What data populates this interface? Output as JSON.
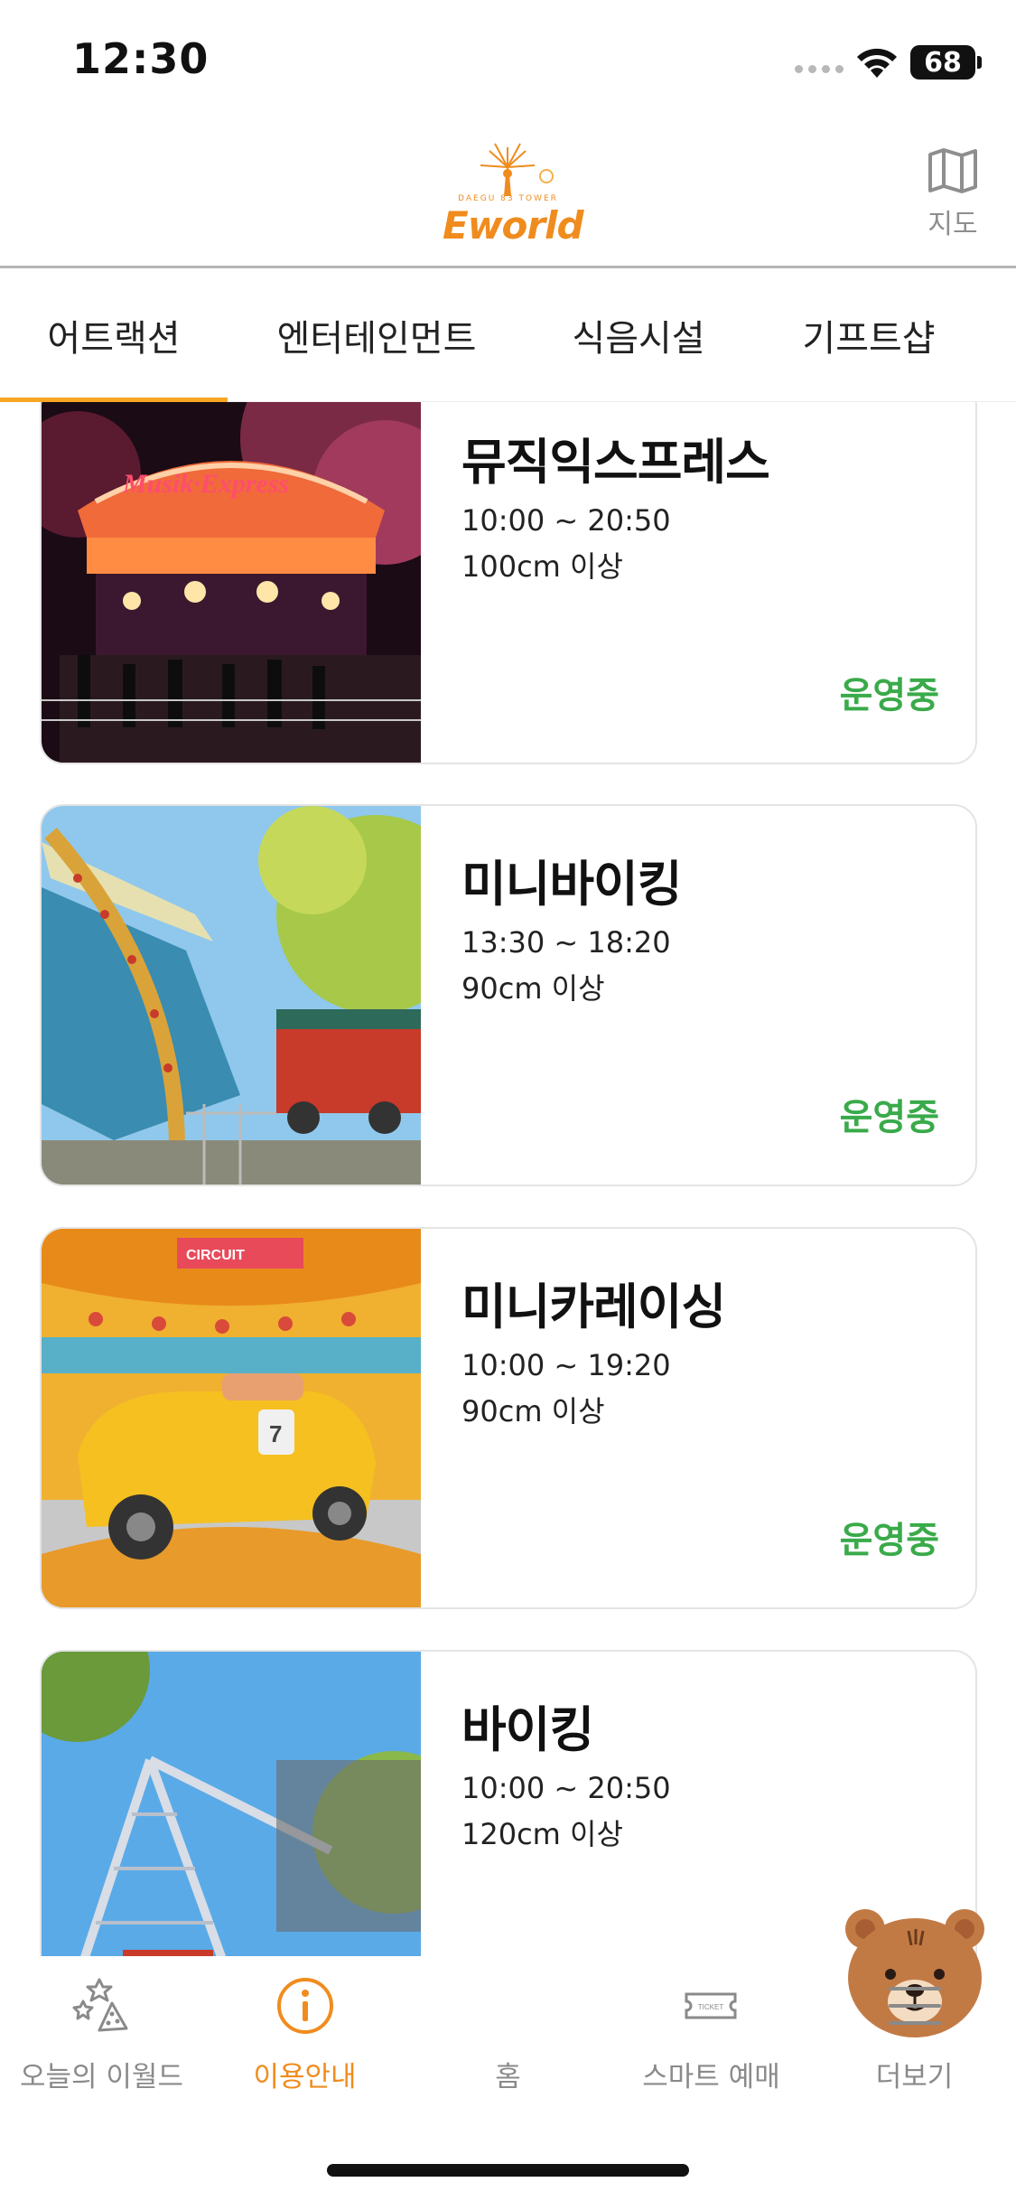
{
  "status_bar": {
    "time": "12:30",
    "battery": "68"
  },
  "header": {
    "logo_text": "Eworld",
    "logo_sub": "DAEGU 83 TOWER",
    "map_label": "지도"
  },
  "tabs": [
    {
      "label": "어트랙션",
      "active": true
    },
    {
      "label": "엔터테인먼트",
      "active": false
    },
    {
      "label": "식음시설",
      "active": false
    },
    {
      "label": "기프트샵",
      "active": false
    }
  ],
  "attractions": [
    {
      "title": "뮤직익스프레스",
      "hours": "10:00 ~ 20:50",
      "height": "100cm 이상",
      "status": "운영중"
    },
    {
      "title": "미니바이킹",
      "hours": "13:30 ~ 18:20",
      "height": "90cm 이상",
      "status": "운영중"
    },
    {
      "title": "미니카레이싱",
      "hours": "10:00 ~ 19:20",
      "height": "90cm 이상",
      "status": "운영중"
    },
    {
      "title": "바이킹",
      "hours": "10:00 ~ 20:50",
      "height": "120cm 이상",
      "status": ""
    }
  ],
  "bottom_nav": [
    {
      "label": "오늘의 이월드",
      "icon": "fireworks-icon"
    },
    {
      "label": "이용안내",
      "icon": "info-icon",
      "active": true
    },
    {
      "label": "홈",
      "icon": "bear-home-icon"
    },
    {
      "label": "스마트 예매",
      "icon": "ticket-icon"
    },
    {
      "label": "더보기",
      "icon": "menu-icon"
    }
  ],
  "colors": {
    "accent": "#f08c1e",
    "tab_underline": "#f5a623",
    "status_green": "#3aaa4a"
  }
}
